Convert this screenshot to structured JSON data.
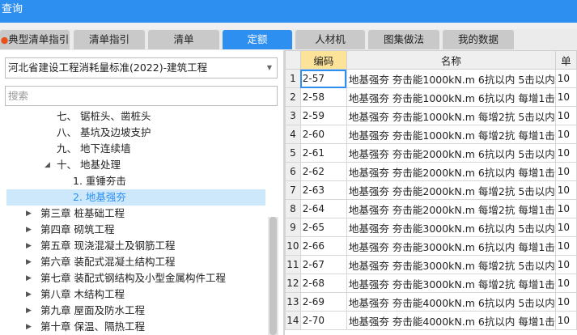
{
  "window": {
    "title": "查询"
  },
  "tabs": [
    {
      "label": "典型清单指引",
      "icon": "flame-icon"
    },
    {
      "label": "清单指引"
    },
    {
      "label": "清单"
    },
    {
      "label": "定额",
      "active": true
    },
    {
      "label": "人材机"
    },
    {
      "label": "图集做法"
    },
    {
      "label": "我的数据"
    }
  ],
  "left_panel": {
    "standard_select": "河北省建设工程消耗量标准(2022)-建筑工程",
    "search_placeholder": "搜索",
    "tree": [
      {
        "label": "七、 锯桩头、凿桩头",
        "level": 3
      },
      {
        "label": "八、 基坑及边坡支护",
        "level": 3
      },
      {
        "label": "九、 地下连续墙",
        "level": 3
      },
      {
        "label": "十、 地基处理",
        "level": 3,
        "expanded": true
      },
      {
        "label": "1. 重锤夯击",
        "level": 4
      },
      {
        "label": "2. 地基强夯",
        "level": 4,
        "selected": true
      },
      {
        "label": "第三章 桩基础工程",
        "level": 1
      },
      {
        "label": "第四章 砌筑工程",
        "level": 1
      },
      {
        "label": "第五章 现浇混凝土及钢筋工程",
        "level": 1
      },
      {
        "label": "第六章 装配式混凝土结构工程",
        "level": 1
      },
      {
        "label": "第七章 装配式钢结构及小型金属构件工程",
        "level": 1
      },
      {
        "label": "第八章 木结构工程",
        "level": 1
      },
      {
        "label": "第九章 屋面及防水工程",
        "level": 1
      },
      {
        "label": "第十章 保温、隔热工程",
        "level": 1
      }
    ]
  },
  "grid": {
    "columns": [
      "编码",
      "名称",
      "单"
    ],
    "rows": [
      {
        "no": "1",
        "code": "2-57",
        "name": "地基强夯 夯击能1000kN.m 6抗以内 5击以内",
        "extra": "10"
      },
      {
        "no": "2",
        "code": "2-58",
        "name": "地基强夯 夯击能1000kN.m 6抗以内 每增1击",
        "extra": "10"
      },
      {
        "no": "3",
        "code": "2-59",
        "name": "地基强夯 夯击能1000kN.m 每增2抗 5击以内",
        "extra": "10"
      },
      {
        "no": "4",
        "code": "2-60",
        "name": "地基强夯 夯击能1000kN.m 每增2抗 每增1击",
        "extra": "10"
      },
      {
        "no": "5",
        "code": "2-61",
        "name": "地基强夯 夯击能2000kN.m 6抗以内 5击以内",
        "extra": "10"
      },
      {
        "no": "6",
        "code": "2-62",
        "name": "地基强夯 夯击能2000kN.m 6抗以内 每增1击",
        "extra": "10"
      },
      {
        "no": "7",
        "code": "2-63",
        "name": "地基强夯 夯击能2000kN.m 每增2抗 5击以内",
        "extra": "10"
      },
      {
        "no": "8",
        "code": "2-64",
        "name": "地基强夯 夯击能2000kN.m 每增2抗 每增1击",
        "extra": "10"
      },
      {
        "no": "9",
        "code": "2-65",
        "name": "地基强夯 夯击能3000kN.m 6抗以内 5击以内",
        "extra": "10"
      },
      {
        "no": "10",
        "code": "2-66",
        "name": "地基强夯 夯击能3000kN.m 6抗以内 每增1击",
        "extra": "10"
      },
      {
        "no": "11",
        "code": "2-67",
        "name": "地基强夯 夯击能3000kN.m 每增2抗 5击以内",
        "extra": "10"
      },
      {
        "no": "12",
        "code": "2-68",
        "name": "地基强夯 夯击能3000kN.m 每增2抗 每增1击",
        "extra": "10"
      },
      {
        "no": "13",
        "code": "2-69",
        "name": "地基强夯 夯击能4000kN.m 6抗以内 5击以内",
        "extra": "10"
      },
      {
        "no": "14",
        "code": "2-70",
        "name": "地基强夯 夯击能4000kN.m 6抗以内 每增1击",
        "extra": "10"
      }
    ]
  },
  "colors": {
    "accent": "#2d8ff0",
    "header_highlight": "#fde39a",
    "selection": "#cde8fb"
  }
}
